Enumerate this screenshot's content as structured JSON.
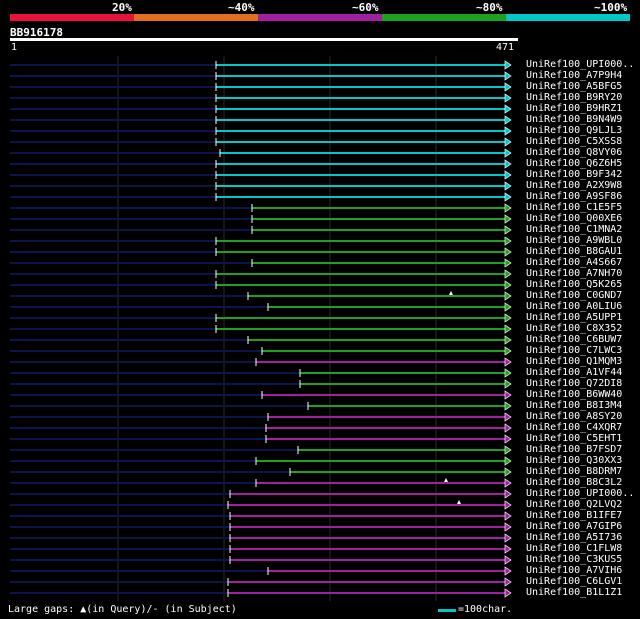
{
  "legend": {
    "labels": [
      "20%",
      "~40%",
      "~60%",
      "~80%",
      "~100%"
    ],
    "colors": [
      "#e8123a",
      "#e07020",
      "#a020a0",
      "#20a020",
      "#00c8c8"
    ]
  },
  "query": {
    "id": "BB916178",
    "start": "1",
    "end": "471"
  },
  "hits": [
    {
      "name": "UniRef100_UPI000..",
      "start": 216,
      "color": "#00c8c8"
    },
    {
      "name": "UniRef100_A7P9H4",
      "start": 216,
      "color": "#00c8c8"
    },
    {
      "name": "UniRef100_A5BFG5",
      "start": 216,
      "color": "#00c8c8"
    },
    {
      "name": "UniRef100_B9RY20",
      "start": 216,
      "color": "#00c8c8"
    },
    {
      "name": "UniRef100_B9HRZ1",
      "start": 216,
      "color": "#00c8c8"
    },
    {
      "name": "UniRef100_B9N4W9",
      "start": 216,
      "color": "#00c8c8"
    },
    {
      "name": "UniRef100_Q9LJL3",
      "start": 216,
      "color": "#00c8c8"
    },
    {
      "name": "UniRef100_C5XSS8",
      "start": 216,
      "color": "#00c8c8"
    },
    {
      "name": "UniRef100_Q8VY06",
      "start": 220,
      "color": "#00c8c8"
    },
    {
      "name": "UniRef100_Q6Z6H5",
      "start": 216,
      "color": "#00c8c8"
    },
    {
      "name": "UniRef100_B9F342",
      "start": 216,
      "color": "#00c8c8"
    },
    {
      "name": "UniRef100_A2X9W8",
      "start": 216,
      "color": "#00c8c8"
    },
    {
      "name": "UniRef100_A9SF86",
      "start": 216,
      "color": "#00c8c8"
    },
    {
      "name": "UniRef100_C1E5F5",
      "start": 252,
      "color": "#20a020"
    },
    {
      "name": "UniRef100_Q00XE6",
      "start": 252,
      "color": "#20a020"
    },
    {
      "name": "UniRef100_C1MNA2",
      "start": 252,
      "color": "#20a020"
    },
    {
      "name": "UniRef100_A9WBL0",
      "start": 216,
      "color": "#20a020"
    },
    {
      "name": "UniRef100_B8GAU1",
      "start": 216,
      "color": "#20a020"
    },
    {
      "name": "UniRef100_A4S667",
      "start": 252,
      "color": "#20a020"
    },
    {
      "name": "UniRef100_A7NH70",
      "start": 216,
      "color": "#20a020"
    },
    {
      "name": "UniRef100_Q5K265",
      "start": 216,
      "color": "#20a020"
    },
    {
      "name": "UniRef100_C0GND7",
      "start": 248,
      "color": "#20a020",
      "gap": 451
    },
    {
      "name": "UniRef100_A0LIU6",
      "start": 268,
      "color": "#20a020"
    },
    {
      "name": "UniRef100_A5UPP1",
      "start": 216,
      "color": "#20a020"
    },
    {
      "name": "UniRef100_C8X352",
      "start": 216,
      "color": "#20a020"
    },
    {
      "name": "UniRef100_C6BUW7",
      "start": 248,
      "color": "#20a020"
    },
    {
      "name": "UniRef100_C7LWC3",
      "start": 262,
      "color": "#20a020"
    },
    {
      "name": "UniRef100_Q1MQM3",
      "start": 256,
      "color": "#a020a0"
    },
    {
      "name": "UniRef100_A1VF44",
      "start": 300,
      "color": "#20a020"
    },
    {
      "name": "UniRef100_Q72DI8",
      "start": 300,
      "color": "#20a020"
    },
    {
      "name": "UniRef100_B6WW40",
      "start": 262,
      "color": "#a020a0"
    },
    {
      "name": "UniRef100_B8I3M4",
      "start": 308,
      "color": "#20a020"
    },
    {
      "name": "UniRef100_A8SY20",
      "start": 268,
      "color": "#a020a0"
    },
    {
      "name": "UniRef100_C4XQR7",
      "start": 266,
      "color": "#a020a0"
    },
    {
      "name": "UniRef100_C5EHT1",
      "start": 266,
      "color": "#a020a0"
    },
    {
      "name": "UniRef100_B7FSD7",
      "start": 298,
      "color": "#20a020"
    },
    {
      "name": "UniRef100_Q30XX3",
      "start": 256,
      "color": "#20a020"
    },
    {
      "name": "UniRef100_B8DRM7",
      "start": 290,
      "color": "#20a020"
    },
    {
      "name": "UniRef100_B8C3L2",
      "start": 256,
      "color": "#a020a0",
      "gap": 446
    },
    {
      "name": "UniRef100_UPI000..",
      "start": 230,
      "color": "#a020a0"
    },
    {
      "name": "UniRef100_Q2LVQ2",
      "start": 228,
      "color": "#a020a0",
      "gap": 459
    },
    {
      "name": "UniRef100_B1IFE7",
      "start": 230,
      "color": "#a020a0"
    },
    {
      "name": "UniRef100_A7GIP6",
      "start": 230,
      "color": "#a020a0"
    },
    {
      "name": "UniRef100_A5I736",
      "start": 230,
      "color": "#a020a0"
    },
    {
      "name": "UniRef100_C1FLW8",
      "start": 230,
      "color": "#a020a0"
    },
    {
      "name": "UniRef100_C3KUS5",
      "start": 230,
      "color": "#a020a0"
    },
    {
      "name": "UniRef100_A7VIH6",
      "start": 268,
      "color": "#a020a0"
    },
    {
      "name": "UniRef100_C6LGV1",
      "start": 228,
      "color": "#a020a0"
    },
    {
      "name": "UniRef100_B1L1Z1",
      "start": 228,
      "color": "#a020a0"
    }
  ],
  "footer": {
    "text": "Large gaps: ▲(in Query)/- (in Subject)",
    "scale": "=100char."
  }
}
